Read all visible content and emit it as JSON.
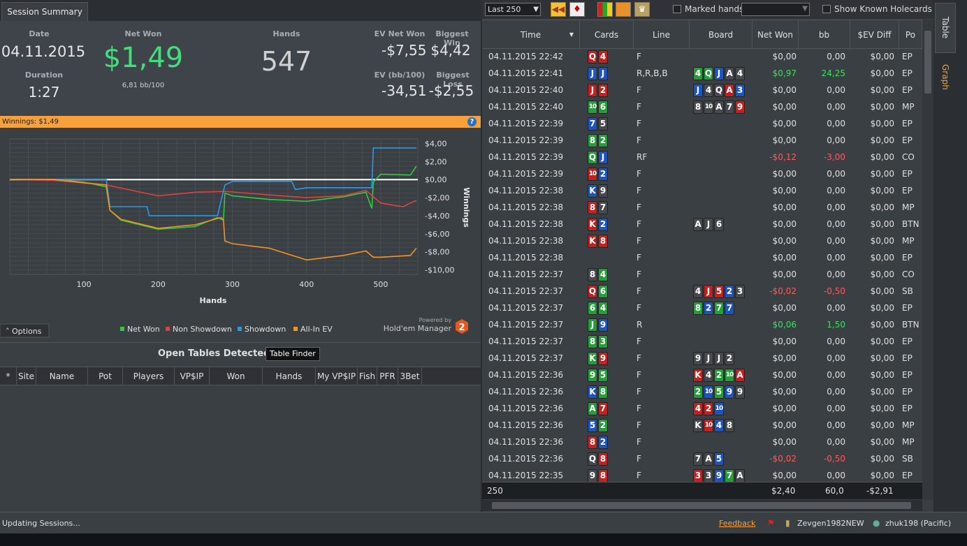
{
  "left": {
    "tab": "Session Summary",
    "summary": {
      "date_label": "Date",
      "date": "04.11.2015",
      "duration_label": "Duration",
      "duration": "1:27",
      "net_won_label": "Net Won",
      "net_won": "$1,49",
      "bb100": "6,81 bb/100",
      "hands_label": "Hands",
      "hands": "547",
      "ev_net_won_label": "EV Net Won",
      "ev_net_won": "-$7,55",
      "biggest_win_label": "Biggest Win",
      "biggest_win": "$4,42",
      "ev_bb100_label": "EV (bb/100)",
      "ev_bb100": "-34,51",
      "biggest_loss_label": "Biggest Loss",
      "biggest_loss": "-$2,55"
    },
    "winnings_bar": "Winnings: $1,49",
    "options_label": "Options",
    "powered_by": "Powered by",
    "hm_name": "Hold'em Manager",
    "hm_version": "2",
    "open_tables": {
      "title": "Open Tables Detected",
      "finder_button": "Table Finder",
      "columns": [
        "*",
        "Site",
        "Name",
        "Pot",
        "Players",
        "VP$IP",
        "Won",
        "Hands",
        "My VP$IP",
        "Fish",
        "PFR",
        "3Bet"
      ]
    }
  },
  "chart_data": {
    "type": "line",
    "xlabel": "Hands",
    "ylabel": "Winnings",
    "x_ticks": [
      100,
      200,
      300,
      400,
      500
    ],
    "y_ticks": [
      "$4,00",
      "$2,00",
      "$0,00",
      "-$2,00",
      "-$4,00",
      "-$6,00",
      "-$8,00",
      "-$10,00"
    ],
    "xlim": [
      0,
      550
    ],
    "ylim": [
      -10.5,
      4.5
    ],
    "grid": true,
    "legend_position": "bottom",
    "series": [
      {
        "name": "Net Won",
        "color": "#2ecc40",
        "x": [
          0,
          60,
          100,
          130,
          135,
          150,
          200,
          250,
          280,
          288,
          290,
          300,
          350,
          400,
          450,
          480,
          488,
          490,
          500,
          540,
          548
        ],
        "y": [
          0,
          0,
          -0.3,
          -0.8,
          -3.4,
          -4.5,
          -5.5,
          -5.2,
          -4.2,
          -4.5,
          -1.5,
          -1.8,
          -2.2,
          -2.4,
          -1.9,
          -1.4,
          -3.2,
          -0.3,
          0.6,
          0.5,
          1.49
        ]
      },
      {
        "name": "Non Showdown",
        "color": "#e04040",
        "x": [
          0,
          60,
          130,
          200,
          250,
          290,
          350,
          400,
          450,
          480,
          500,
          530,
          548
        ],
        "y": [
          0,
          -0.1,
          -0.6,
          -1.8,
          -1.4,
          -1.3,
          -1.7,
          -2.0,
          -1.8,
          -1.2,
          -2.6,
          -3.0,
          -2.3
        ]
      },
      {
        "name": "Showdown",
        "color": "#2a9ae8",
        "x": [
          0,
          130,
          135,
          185,
          188,
          280,
          290,
          300,
          380,
          385,
          400,
          488,
          490,
          500,
          548
        ],
        "y": [
          0,
          0,
          -3.0,
          -3.0,
          -4.0,
          -4.0,
          -0.6,
          -0.2,
          -0.2,
          -1.1,
          -0.9,
          -0.9,
          3.5,
          3.5,
          3.5
        ]
      },
      {
        "name": "All-In EV",
        "color": "#f7931e",
        "x": [
          0,
          60,
          130,
          135,
          150,
          200,
          250,
          285,
          288,
          290,
          300,
          350,
          400,
          450,
          480,
          490,
          500,
          540,
          548
        ],
        "y": [
          0,
          0,
          -0.6,
          -3.4,
          -4.4,
          -5.4,
          -5.0,
          -4.2,
          -4.5,
          -6.8,
          -7.1,
          -7.6,
          -8.9,
          -8.4,
          -7.9,
          -8.6,
          -8.6,
          -8.4,
          -7.6
        ]
      }
    ]
  },
  "right": {
    "filter": "Last 250",
    "marked_hands": "Marked hands",
    "show_known": "Show Known Holecards",
    "columns": [
      "Time",
      "Cards",
      "Line",
      "Board",
      "Net Won",
      "bb",
      "$EV Diff",
      "Po"
    ],
    "rows": [
      {
        "time": "04.11.2015 22:42",
        "cards": [
          "Q",
          "4"
        ],
        "cs": [
          "h",
          "h"
        ],
        "line": "F",
        "board": [],
        "bs": [],
        "net": "$0,00",
        "bb": "0,00",
        "ev": "$0,00",
        "pos": "EP"
      },
      {
        "time": "04.11.2015 22:41",
        "cards": [
          "J",
          "J"
        ],
        "cs": [
          "d",
          "d"
        ],
        "line": "R,R,B,B",
        "board": [
          "4",
          "Q",
          "J",
          "A",
          "4"
        ],
        "bs": [
          "c",
          "c",
          "d",
          "s",
          "s"
        ],
        "net": "$0,97",
        "bb": "24,25",
        "ev": "$0,00",
        "pos": "EP",
        "sign": "pos"
      },
      {
        "time": "04.11.2015 22:40",
        "cards": [
          "J",
          "2"
        ],
        "cs": [
          "h",
          "h"
        ],
        "line": "F",
        "board": [
          "J",
          "4",
          "Q",
          "A",
          "3"
        ],
        "bs": [
          "d",
          "s",
          "s",
          "h",
          "d"
        ],
        "net": "$0,00",
        "bb": "0,00",
        "ev": "$0,00",
        "pos": "EP"
      },
      {
        "time": "04.11.2015 22:40",
        "cards": [
          "10",
          "6"
        ],
        "cs": [
          "c",
          "c"
        ],
        "line": "F",
        "board": [
          "8",
          "10",
          "A",
          "7",
          "9"
        ],
        "bs": [
          "s",
          "s",
          "s",
          "s",
          "h"
        ],
        "net": "$0,00",
        "bb": "0,00",
        "ev": "$0,00",
        "pos": "MP"
      },
      {
        "time": "04.11.2015 22:39",
        "cards": [
          "7",
          "5"
        ],
        "cs": [
          "d",
          "s"
        ],
        "line": "F",
        "board": [],
        "bs": [],
        "net": "$0,00",
        "bb": "0,00",
        "ev": "$0,00",
        "pos": "EP"
      },
      {
        "time": "04.11.2015 22:39",
        "cards": [
          "8",
          "2"
        ],
        "cs": [
          "c",
          "c"
        ],
        "line": "F",
        "board": [],
        "bs": [],
        "net": "$0,00",
        "bb": "0,00",
        "ev": "$0,00",
        "pos": "EP"
      },
      {
        "time": "04.11.2015 22:39",
        "cards": [
          "Q",
          "J"
        ],
        "cs": [
          "c",
          "d"
        ],
        "line": "RF",
        "board": [],
        "bs": [],
        "net": "-$0,12",
        "bb": "-3,00",
        "ev": "$0,00",
        "pos": "CO",
        "sign": "neg"
      },
      {
        "time": "04.11.2015 22:39",
        "cards": [
          "10",
          "2"
        ],
        "cs": [
          "h",
          "d"
        ],
        "line": "F",
        "board": [],
        "bs": [],
        "net": "$0,00",
        "bb": "0,00",
        "ev": "$0,00",
        "pos": "EP"
      },
      {
        "time": "04.11.2015 22:38",
        "cards": [
          "K",
          "9"
        ],
        "cs": [
          "d",
          "s"
        ],
        "line": "F",
        "board": [],
        "bs": [],
        "net": "$0,00",
        "bb": "0,00",
        "ev": "$0,00",
        "pos": "EP"
      },
      {
        "time": "04.11.2015 22:38",
        "cards": [
          "8",
          "7"
        ],
        "cs": [
          "h",
          "s"
        ],
        "line": "F",
        "board": [],
        "bs": [],
        "net": "$0,00",
        "bb": "0,00",
        "ev": "$0,00",
        "pos": "MP"
      },
      {
        "time": "04.11.2015 22:38",
        "cards": [
          "K",
          "2"
        ],
        "cs": [
          "h",
          "d"
        ],
        "line": "F",
        "board": [
          "A",
          "J",
          "6"
        ],
        "bs": [
          "s",
          "s",
          "s"
        ],
        "net": "$0,00",
        "bb": "0,00",
        "ev": "$0,00",
        "pos": "BTN"
      },
      {
        "time": "04.11.2015 22:38",
        "cards": [
          "K",
          "8"
        ],
        "cs": [
          "h",
          "h"
        ],
        "line": "F",
        "board": [],
        "bs": [],
        "net": "$0,00",
        "bb": "0,00",
        "ev": "$0,00",
        "pos": "MP"
      },
      {
        "time": "04.11.2015 22:38",
        "cards": [],
        "cs": [],
        "line": "F",
        "board": [],
        "bs": [],
        "net": "$0,00",
        "bb": "0,00",
        "ev": "$0,00",
        "pos": "EP"
      },
      {
        "time": "04.11.2015 22:37",
        "cards": [
          "8",
          "4"
        ],
        "cs": [
          "s",
          "c"
        ],
        "line": "F",
        "board": [],
        "bs": [],
        "net": "$0,00",
        "bb": "0,00",
        "ev": "$0,00",
        "pos": "CO"
      },
      {
        "time": "04.11.2015 22:37",
        "cards": [
          "Q",
          "6"
        ],
        "cs": [
          "h",
          "c"
        ],
        "line": "F",
        "board": [
          "4",
          "J",
          "5",
          "2",
          "3"
        ],
        "bs": [
          "s",
          "h",
          "h",
          "d",
          "s"
        ],
        "net": "-$0,02",
        "bb": "-0,50",
        "ev": "$0,00",
        "pos": "SB",
        "sign": "neg"
      },
      {
        "time": "04.11.2015 22:37",
        "cards": [
          "6",
          "4"
        ],
        "cs": [
          "c",
          "c"
        ],
        "line": "F",
        "board": [
          "8",
          "2",
          "7",
          "7"
        ],
        "bs": [
          "c",
          "d",
          "c",
          "d"
        ],
        "net": "$0,00",
        "bb": "0,00",
        "ev": "$0,00",
        "pos": "EP"
      },
      {
        "time": "04.11.2015 22:37",
        "cards": [
          "J",
          "9"
        ],
        "cs": [
          "c",
          "d"
        ],
        "line": "R",
        "board": [],
        "bs": [],
        "net": "$0,06",
        "bb": "1,50",
        "ev": "$0,00",
        "pos": "BTN",
        "sign": "pos"
      },
      {
        "time": "04.11.2015 22:37",
        "cards": [
          "8",
          "3"
        ],
        "cs": [
          "c",
          "c"
        ],
        "line": "F",
        "board": [],
        "bs": [],
        "net": "$0,00",
        "bb": "0,00",
        "ev": "$0,00",
        "pos": "EP"
      },
      {
        "time": "04.11.2015 22:37",
        "cards": [
          "K",
          "9"
        ],
        "cs": [
          "c",
          "h"
        ],
        "line": "F",
        "board": [
          "9",
          "J",
          "J",
          "2"
        ],
        "bs": [
          "s",
          "s",
          "s",
          "s"
        ],
        "net": "$0,00",
        "bb": "0,00",
        "ev": "$0,00",
        "pos": "EP"
      },
      {
        "time": "04.11.2015 22:36",
        "cards": [
          "9",
          "5"
        ],
        "cs": [
          "c",
          "c"
        ],
        "line": "F",
        "board": [
          "K",
          "4",
          "2",
          "10",
          "A"
        ],
        "bs": [
          "h",
          "s",
          "c",
          "c",
          "h"
        ],
        "net": "$0,00",
        "bb": "0,00",
        "ev": "$0,00",
        "pos": "EP"
      },
      {
        "time": "04.11.2015 22:36",
        "cards": [
          "K",
          "8"
        ],
        "cs": [
          "d",
          "c"
        ],
        "line": "F",
        "board": [
          "2",
          "10",
          "5",
          "9",
          "9"
        ],
        "bs": [
          "c",
          "d",
          "c",
          "d",
          "s"
        ],
        "net": "$0,00",
        "bb": "0,00",
        "ev": "$0,00",
        "pos": "EP"
      },
      {
        "time": "04.11.2015 22:36",
        "cards": [
          "A",
          "7"
        ],
        "cs": [
          "c",
          "h"
        ],
        "line": "F",
        "board": [
          "4",
          "2",
          "10"
        ],
        "bs": [
          "h",
          "h",
          "d"
        ],
        "net": "$0,00",
        "bb": "0,00",
        "ev": "$0,00",
        "pos": "EP"
      },
      {
        "time": "04.11.2015 22:36",
        "cards": [
          "5",
          "2"
        ],
        "cs": [
          "d",
          "c"
        ],
        "line": "F",
        "board": [
          "K",
          "10",
          "4",
          "8"
        ],
        "bs": [
          "s",
          "h",
          "d",
          "s"
        ],
        "net": "$0,00",
        "bb": "0,00",
        "ev": "$0,00",
        "pos": "MP"
      },
      {
        "time": "04.11.2015 22:36",
        "cards": [
          "8",
          "2"
        ],
        "cs": [
          "h",
          "d"
        ],
        "line": "F",
        "board": [],
        "bs": [],
        "net": "$0,00",
        "bb": "0,00",
        "ev": "$0,00",
        "pos": "MP"
      },
      {
        "time": "04.11.2015 22:36",
        "cards": [
          "Q",
          "8"
        ],
        "cs": [
          "s",
          "h"
        ],
        "line": "F",
        "board": [
          "7",
          "A",
          "5"
        ],
        "bs": [
          "s",
          "s",
          "d"
        ],
        "net": "-$0,02",
        "bb": "-0,50",
        "ev": "$0,00",
        "pos": "SB",
        "sign": "neg"
      },
      {
        "time": "04.11.2015 22:35",
        "cards": [
          "9",
          "8"
        ],
        "cs": [
          "s",
          "h"
        ],
        "line": "F",
        "board": [
          "3",
          "3",
          "9",
          "7",
          "A"
        ],
        "bs": [
          "h",
          "s",
          "d",
          "c",
          "s"
        ],
        "net": "$0,00",
        "bb": "0,00",
        "ev": "$0,00",
        "pos": "EP"
      }
    ],
    "footer": {
      "count": "250",
      "net": "$2,40",
      "bb": "60,0",
      "ev": "-$2,91"
    },
    "side_tabs": [
      "Table",
      "Graph"
    ]
  },
  "status": {
    "text": "Updating Sessions...",
    "feedback": "Feedback",
    "account1": "Zevgen1982NEW",
    "account2": "zhuk198 (Pacific)"
  },
  "colors": {
    "orange": "#f8a13a",
    "green": "#3fe060",
    "red": "#ff5a5a"
  }
}
